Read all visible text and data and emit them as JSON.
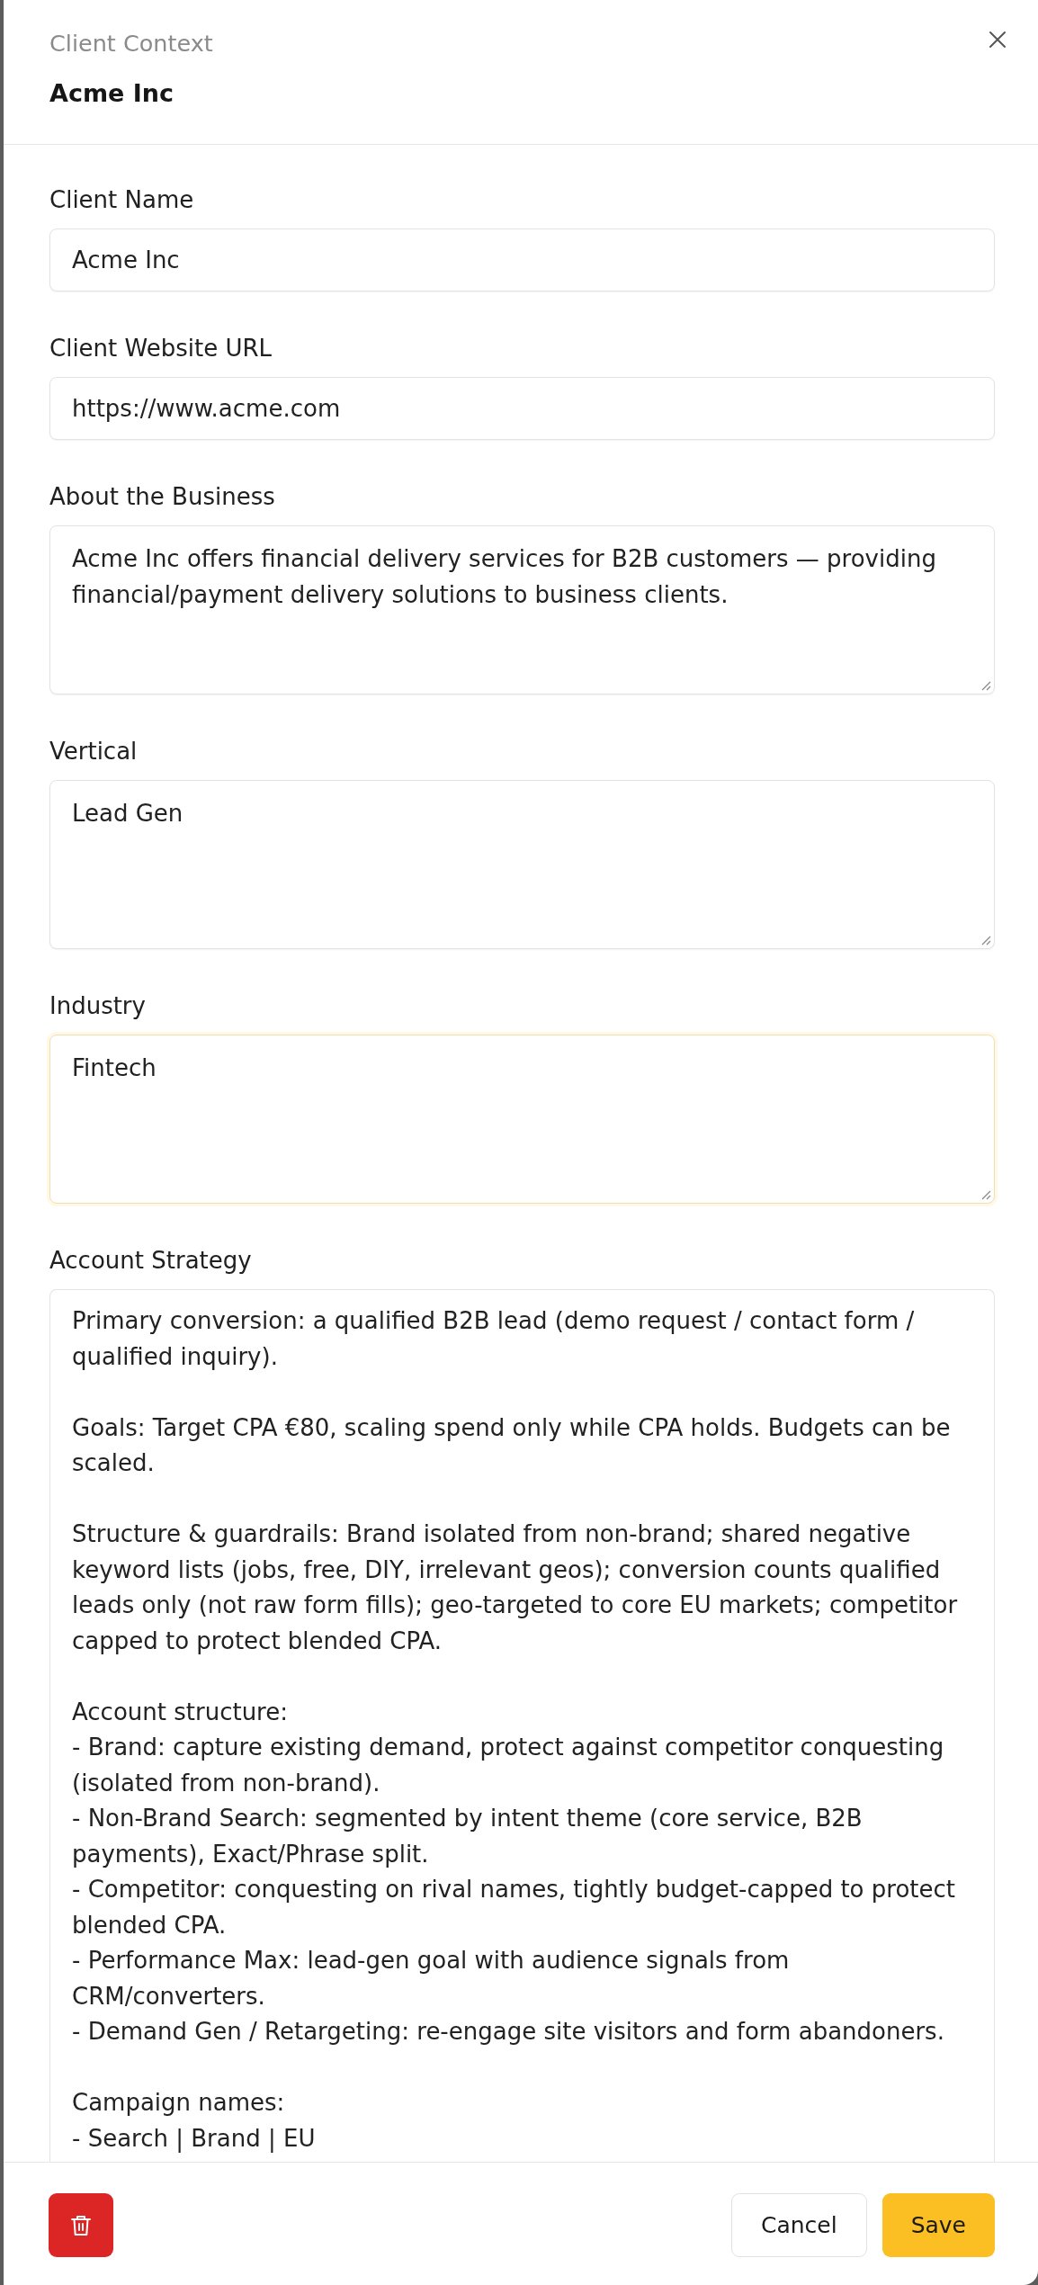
{
  "panel": {
    "subtitle": "Client Context",
    "title": "Acme Inc"
  },
  "fields": [
    {
      "label": "Client Name",
      "kind": "input",
      "value": "Acme Inc",
      "focused": false
    },
    {
      "label": "Client Website URL",
      "kind": "input",
      "value": "https://www.acme.com",
      "focused": false
    },
    {
      "label": "About the Business",
      "kind": "textarea",
      "value": "Acme Inc offers financial delivery services for B2B customers — providing financial/payment delivery solutions to business clients.",
      "focused": false
    },
    {
      "label": "Vertical",
      "kind": "textarea",
      "value": "Lead Gen",
      "focused": false
    },
    {
      "label": "Industry",
      "kind": "textarea",
      "value": "Fintech",
      "focused": true
    },
    {
      "label": "Account Strategy",
      "kind": "textarea",
      "value": "Primary conversion: a qualified B2B lead (demo request / contact form / qualified inquiry).\n\nGoals: Target CPA €80, scaling spend only while CPA holds. Budgets can be scaled.\n\nStructure & guardrails: Brand isolated from non-brand; shared negative keyword lists (jobs, free, DIY, irrelevant geos); conversion counts qualified leads only (not raw form fills); geo-targeted to core EU markets; competitor capped to protect blended CPA.\n\nAccount structure:\n- Brand: capture existing demand, protect against competitor conquesting (isolated from non-brand).\n- Non-Brand Search: segmented by intent theme (core service, B2B payments), Exact/Phrase split.\n- Competitor: conquesting on rival names, tightly budget-capped to protect blended CPA.\n- Performance Max: lead-gen goal with audience signals from CRM/converters.\n- Demand Gen / Retargeting: re-engage site visitors and form abandoners.\n\nCampaign names:\n- Search | Brand | EU",
      "focused": false
    }
  ],
  "footer": {
    "buttons": [
      {
        "kind": "delete"
      },
      {
        "kind": "secondary",
        "label": "Cancel"
      },
      {
        "kind": "primary",
        "label": "Save"
      }
    ]
  }
}
